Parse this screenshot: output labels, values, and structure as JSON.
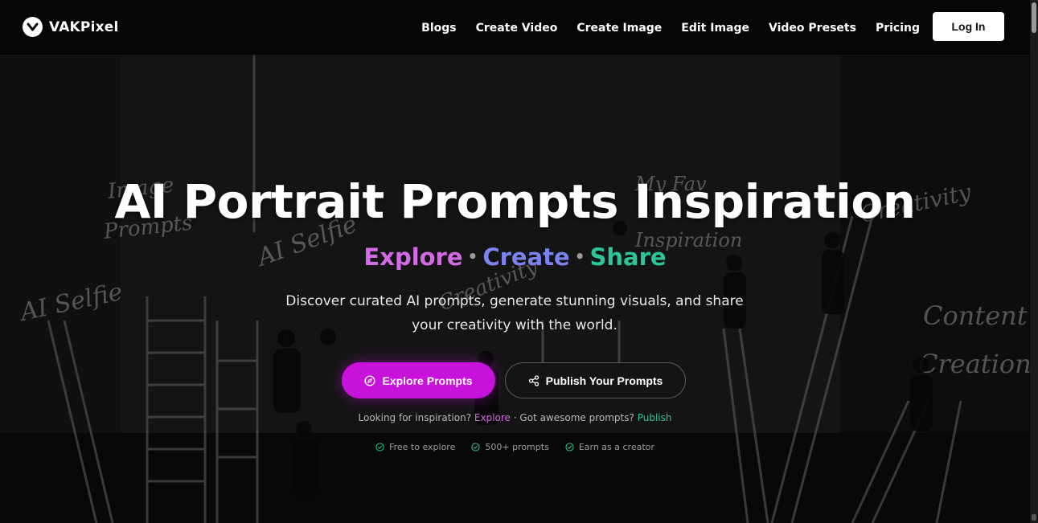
{
  "nav": {
    "brand": "VAKPixel",
    "links": [
      "Blogs",
      "Create Video",
      "Create Image",
      "Edit Image",
      "Video Presets",
      "Pricing"
    ],
    "login_label": "Log In"
  },
  "hero": {
    "title": "AI Portrait Prompts Inspiration",
    "tagline": {
      "explore": "Explore",
      "dot1": "•",
      "create": "Create",
      "dot2": "•",
      "share": "Share"
    },
    "subtitle": "Discover curated AI prompts, generate stunning visuals, and share your creativity with the world.",
    "primary_button": "Explore Prompts",
    "secondary_button": "Publish Your Prompts",
    "hint": {
      "prefix": "Looking for inspiration?",
      "explore_link": "Explore",
      "separator": "·",
      "middle": "Got awesome prompts?",
      "publish_link": "Publish"
    },
    "features": [
      "Free to explore",
      "500+ prompts",
      "Earn as a creator"
    ]
  },
  "background_chalk_words": [
    "Image Prompts",
    "AI Selfie",
    "AI Selfie",
    "Creativity",
    "My Fav Inspiration",
    "Creativity",
    "Content Creation"
  ],
  "colors": {
    "explore": "#d46be6",
    "create": "#7b83f0",
    "share": "#2cc59a",
    "primary_button": "#c812dc"
  },
  "icons": {
    "brand_logo": "chevron-down-in-circle-icon",
    "primary_button": "compass-icon",
    "secondary_button": "share-icon",
    "feature_marks": "check-circle-icon"
  }
}
